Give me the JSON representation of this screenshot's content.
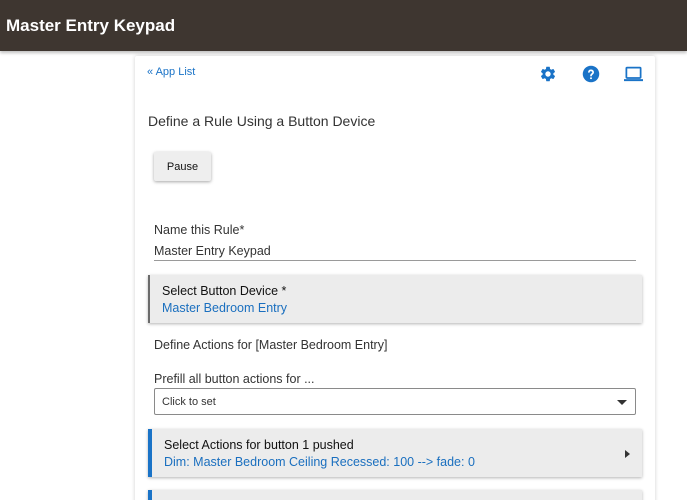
{
  "header": {
    "title": "Master Entry Keypad"
  },
  "nav": {
    "app_list_link": "« App List"
  },
  "toolbar": {
    "icons": [
      "gear-icon",
      "help-icon",
      "laptop-icon"
    ],
    "accent_color": "#1a73c7"
  },
  "page": {
    "heading": "Define a Rule Using a Button Device",
    "pause_label": "Pause",
    "rule_name": {
      "label": "Name this Rule*",
      "value": "Master Entry Keypad"
    },
    "button_device": {
      "title": "Select Button Device *",
      "value": "Master Bedroom Entry"
    },
    "define_actions_text": "Define Actions for [Master Bedroom Entry]",
    "prefill": {
      "label": "Prefill all button actions for ...",
      "value": "Click to set"
    },
    "actions": [
      {
        "title": "Select Actions for button 1 pushed",
        "value": "Dim: Master Bedroom Ceiling Recessed: 100 --> fade: 0"
      }
    ]
  },
  "colors": {
    "topbar": "#3e3630",
    "link": "#1a73c7",
    "section_bg": "#ececec"
  }
}
